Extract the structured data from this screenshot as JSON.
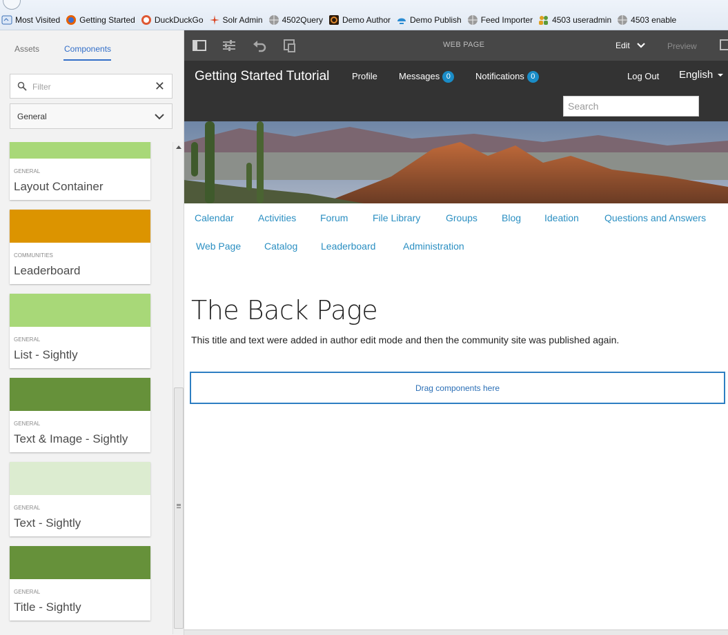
{
  "bookmarks": [
    {
      "label": "Most Visited",
      "icon": "most-visited-icon",
      "color": "#3b6fb6"
    },
    {
      "label": "Getting Started",
      "icon": "firefox-icon",
      "color": "#e66000"
    },
    {
      "label": "DuckDuckGo",
      "icon": "duckduckgo-icon",
      "color": "#de5833"
    },
    {
      "label": "Solr Admin",
      "icon": "solr-icon",
      "color": "#d9411e"
    },
    {
      "label": "4502Query",
      "icon": "globe-icon",
      "color": "#777777"
    },
    {
      "label": "Demo Author",
      "icon": "author-icon",
      "color": "#5a2d0c"
    },
    {
      "label": "Demo Publish",
      "icon": "publish-icon",
      "color": "#2a8bd2"
    },
    {
      "label": "Feed Importer",
      "icon": "globe-icon",
      "color": "#777777"
    },
    {
      "label": "4503 useradmin",
      "icon": "users-icon",
      "color": "#e0a020"
    },
    {
      "label": "4503 enable",
      "icon": "globe-icon",
      "color": "#777777"
    }
  ],
  "sidepanel": {
    "tabs": {
      "assets": "Assets",
      "components": "Components"
    },
    "filter_placeholder": "Filter",
    "group_select": "General",
    "components": [
      {
        "group": "GENERAL",
        "title": "Layout Container",
        "color": "#a8d878"
      },
      {
        "group": "COMMUNITIES",
        "title": "Leaderboard",
        "color": "#dc9400"
      },
      {
        "group": "GENERAL",
        "title": "List - Sightly",
        "color": "#a8d878"
      },
      {
        "group": "GENERAL",
        "title": "Text & Image - Sightly",
        "color": "#66913a"
      },
      {
        "group": "GENERAL",
        "title": "Text - Sightly",
        "color": "#dcecd0"
      },
      {
        "group": "GENERAL",
        "title": "Title - Sightly",
        "color": "#66913a"
      }
    ]
  },
  "toolbar": {
    "title": "WEB PAGE",
    "mode": "Edit",
    "preview": "Preview"
  },
  "site": {
    "title": "Getting Started Tutorial",
    "profile": "Profile",
    "messages": "Messages",
    "messages_count": "0",
    "notifications": "Notifications",
    "notifications_count": "0",
    "logout": "Log Out",
    "language": "English",
    "search_placeholder": "Search",
    "nav_row1": [
      "Calendar",
      "Activities",
      "Forum",
      "File Library",
      "Groups",
      "Blog",
      "Ideation",
      "Questions and Answers"
    ],
    "nav_row2": [
      "Web Page",
      "Catalog",
      "Leaderboard",
      "Administration"
    ]
  },
  "content": {
    "heading": "The Back Page",
    "text": "This title and text were added in author edit mode and then the community site was published again.",
    "dropzone": "Drag components here"
  }
}
